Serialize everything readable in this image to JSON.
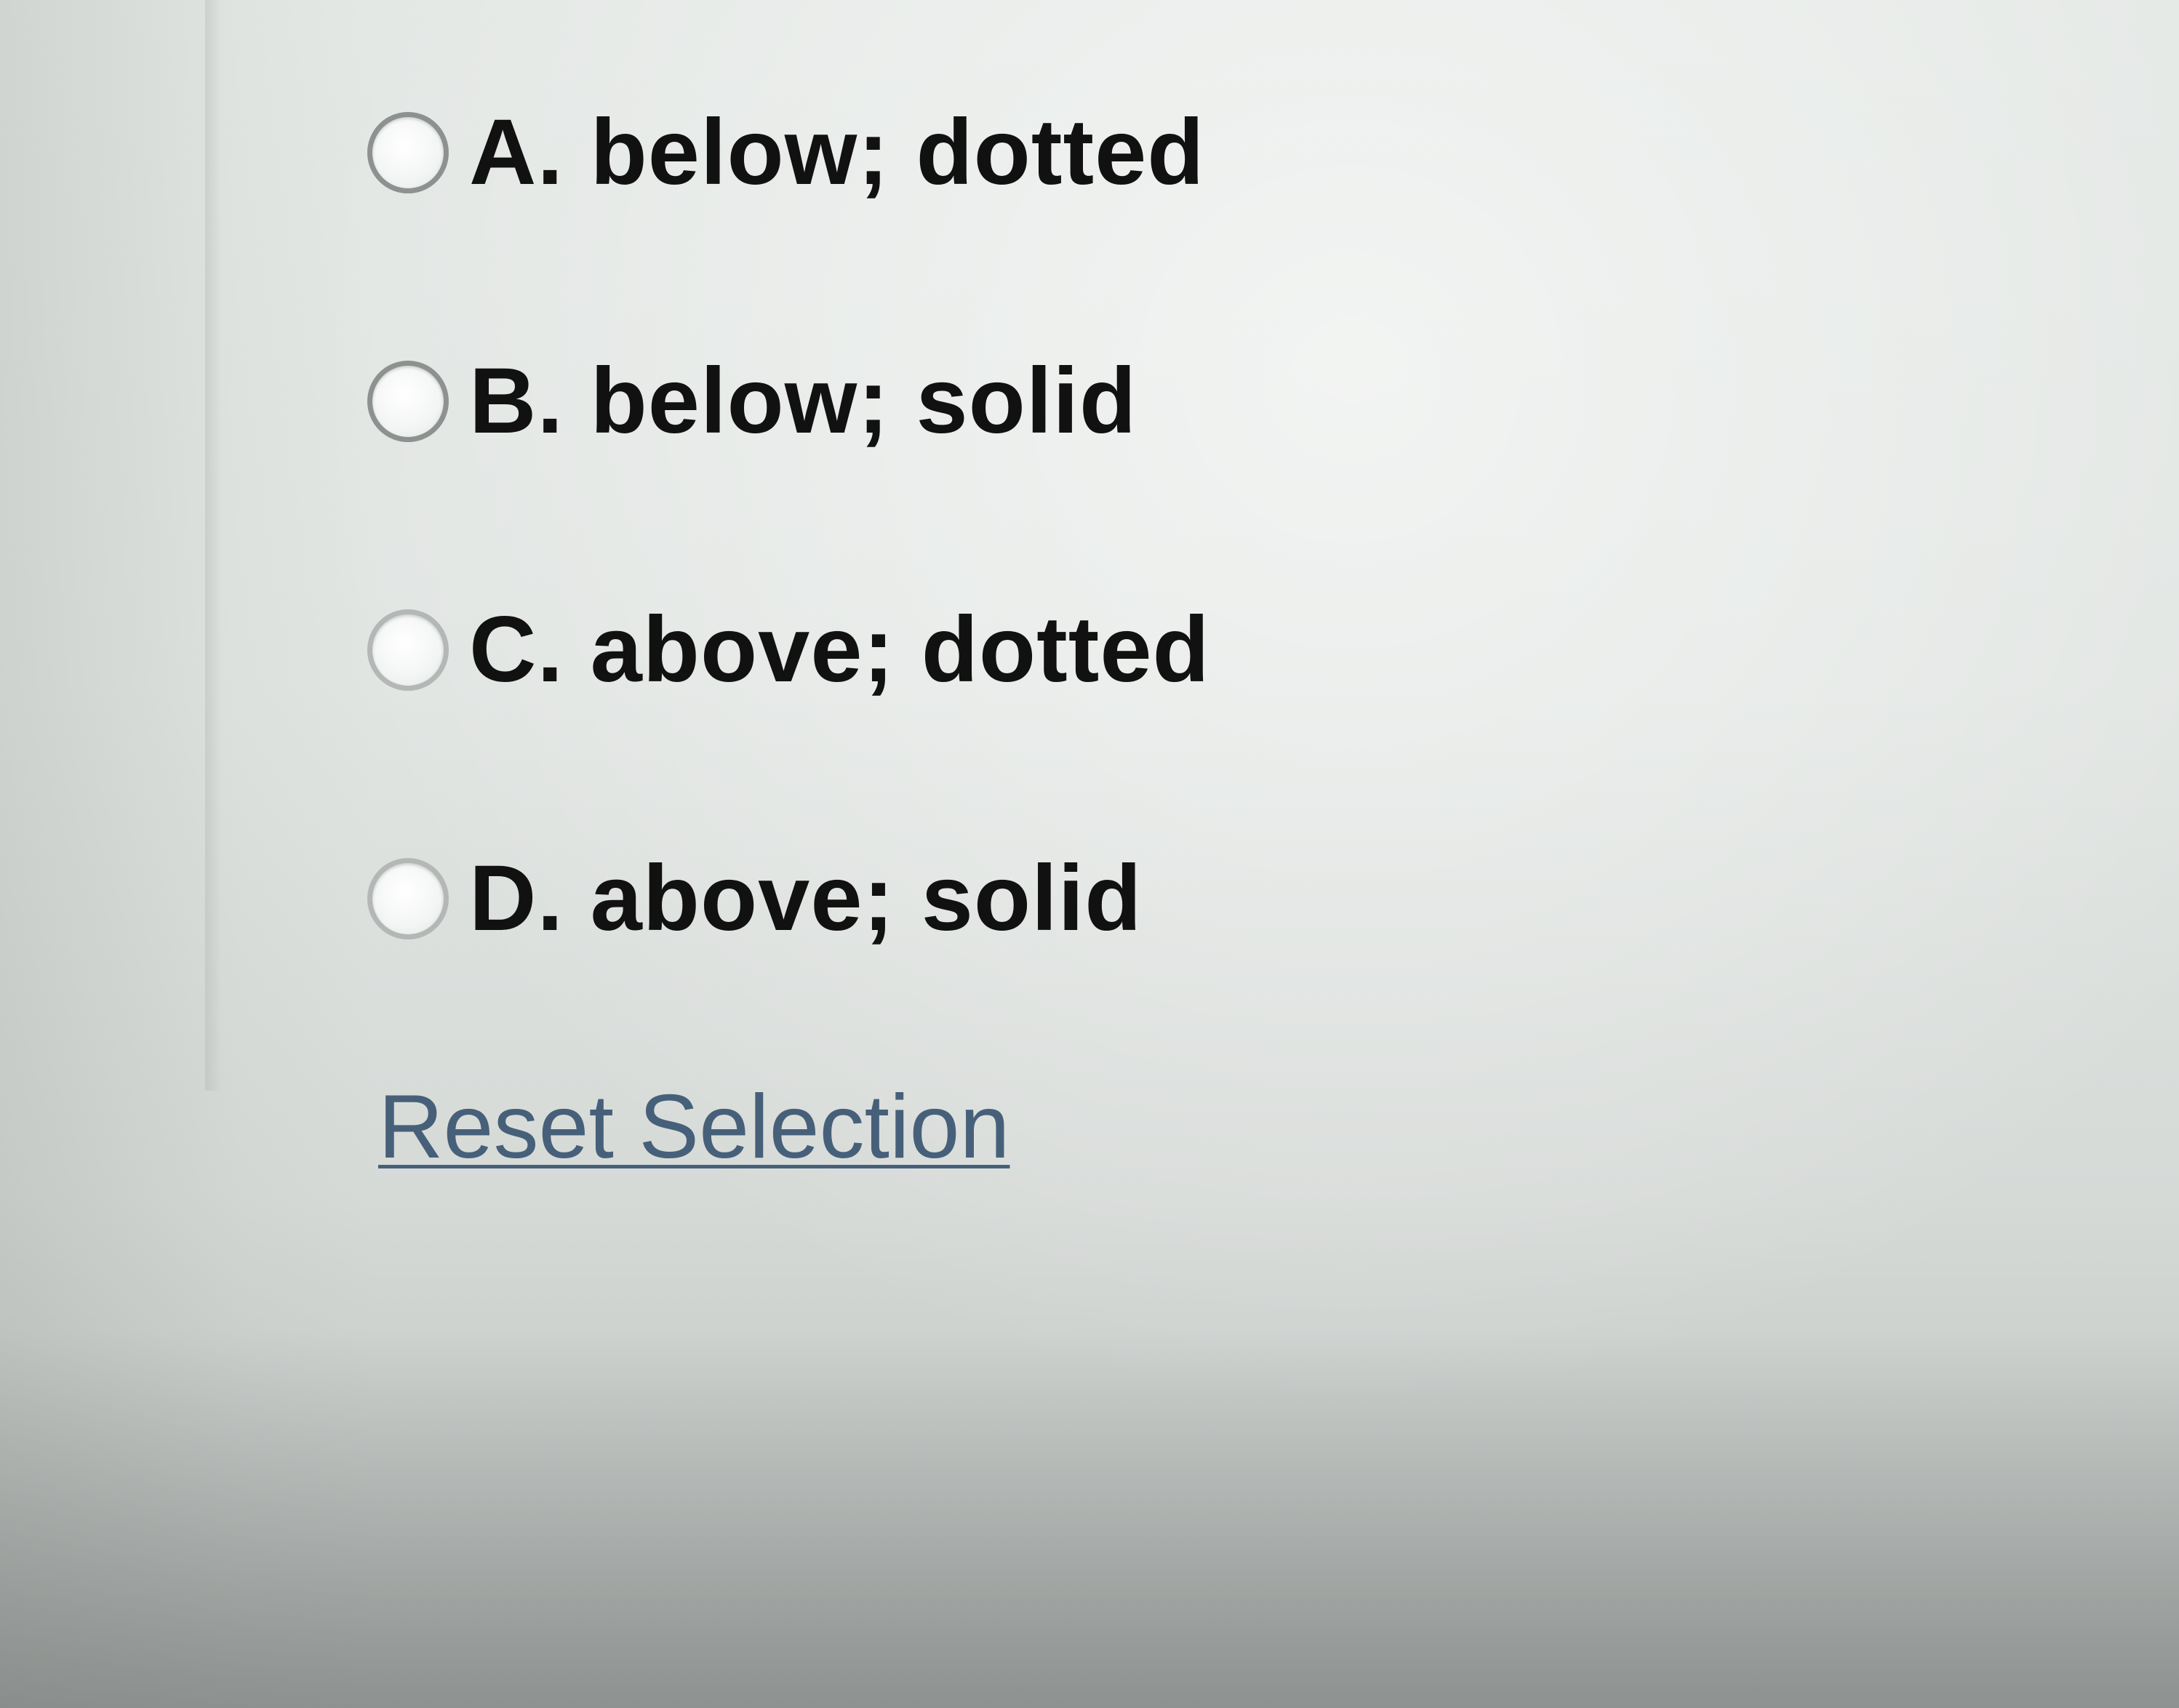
{
  "question": {
    "choices": [
      {
        "letter": "A.",
        "text": "A. below; dotted",
        "selected": false
      },
      {
        "letter": "B.",
        "text": "B. below; solid",
        "selected": false
      },
      {
        "letter": "C.",
        "text": "C. above; dotted",
        "selected": false
      },
      {
        "letter": "D.",
        "text": "D. above; solid",
        "selected": false
      }
    ],
    "reset_label": "Reset Selection"
  },
  "colors": {
    "text": "#111111",
    "link": "#47607a",
    "radio_border": "#8d918f",
    "background": "#e1e5e2"
  }
}
